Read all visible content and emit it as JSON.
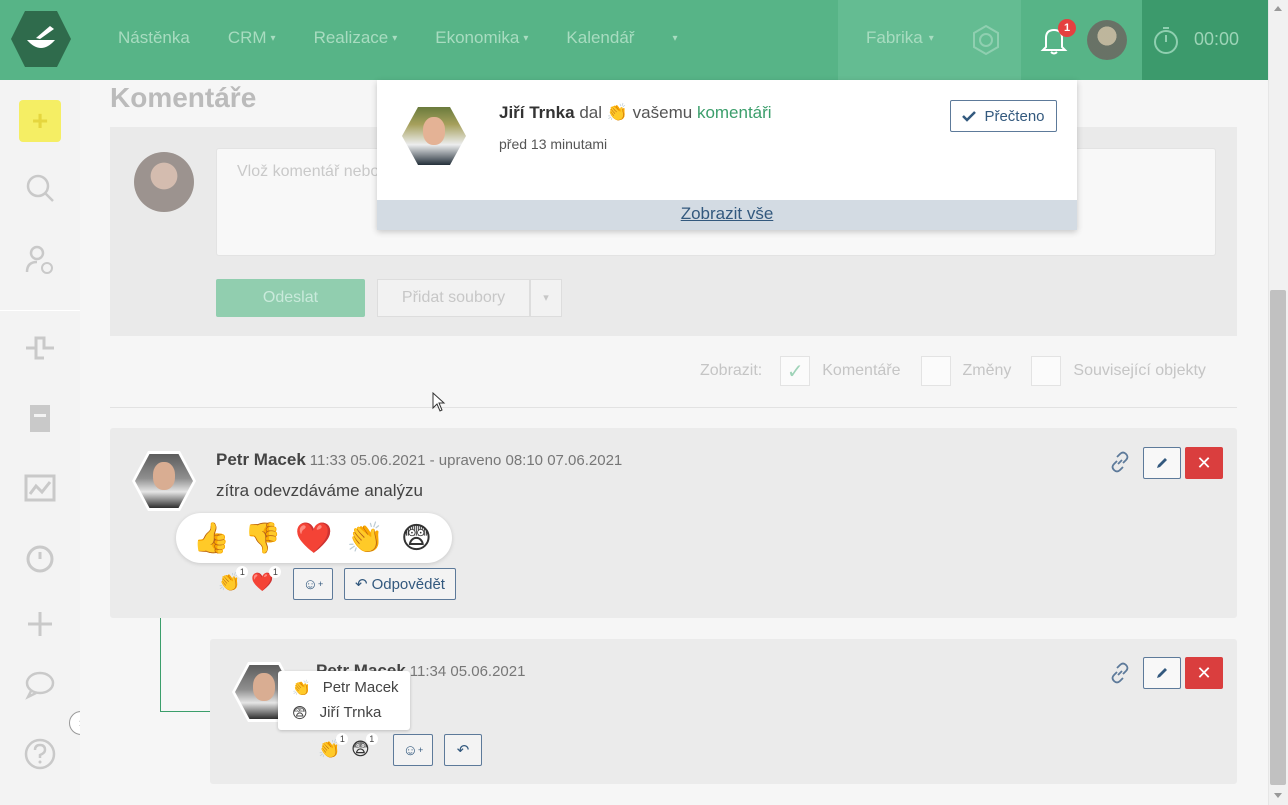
{
  "topbar": {
    "nav": [
      {
        "label": "Nástěnka",
        "has_caret": false
      },
      {
        "label": "CRM",
        "has_caret": true
      },
      {
        "label": "Realizace",
        "has_caret": true
      },
      {
        "label": "Ekonomika",
        "has_caret": true
      },
      {
        "label": "Kalendář",
        "has_caret": false
      }
    ],
    "more_caret": "▾",
    "caret": "▾",
    "company": "Fabrika",
    "notification_count": "1",
    "timer": "00:00"
  },
  "page": {
    "title": "Komentáře",
    "comment_placeholder": "Vlož komentář nebo",
    "send_label": "Odeslat",
    "add_files_label": "Přidat soubory",
    "files_caret": "▾",
    "filter_label": "Zobrazit:",
    "filters": [
      {
        "label": "Komentáře",
        "checked": true
      },
      {
        "label": "Změny",
        "checked": false
      },
      {
        "label": "Související objekty",
        "checked": false
      }
    ],
    "check_glyph": "✓"
  },
  "comments": [
    {
      "author": "Petr Macek",
      "meta": "11:33 05.06.2021 - upraveno 08:10 07.06.2021",
      "text": "zítra odevzdáváme analýzu",
      "reactions": [
        {
          "emoji": "👏",
          "count": "1"
        },
        {
          "emoji": "❤️",
          "count": "1"
        }
      ],
      "reply_label": "Odpovědět"
    },
    {
      "author": "Petr Macek",
      "meta": "11:34 05.06.2021",
      "reactions": [
        {
          "emoji": "👏",
          "count": "1"
        },
        {
          "emoji": "😨",
          "count": "1"
        }
      ]
    }
  ],
  "emoji_picker": [
    "👍",
    "👎",
    "❤️",
    "👏",
    "😨"
  ],
  "reaction_tooltip": [
    {
      "emoji": "👏",
      "name": "Petr Macek"
    },
    {
      "emoji": "😨",
      "name": "Jiří Trnka"
    }
  ],
  "notification": {
    "actor": "Jiří Trnka",
    "verb": "dal",
    "emoji": "👏",
    "middle": "vašemu",
    "link": "komentáři",
    "time": "před 13 minutami",
    "read_label": "Přečteno",
    "show_all": "Zobrazit vše"
  },
  "glyphs": {
    "add_reaction": "☺",
    "add_reaction_plus": "+",
    "reply_arrow": "↶",
    "delete": "✕",
    "expand": "›",
    "sidebar_plus": "+"
  },
  "colors": {
    "brand": "#57b487",
    "danger": "#da3e3e",
    "link": "#3b9e6b",
    "button_outline": "#5d7a9a"
  }
}
